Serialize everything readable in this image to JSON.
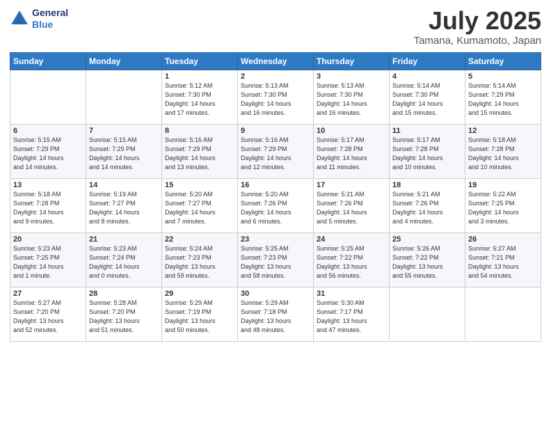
{
  "header": {
    "logo_line1": "General",
    "logo_line2": "Blue",
    "month": "July 2025",
    "location": "Tamana, Kumamoto, Japan"
  },
  "days_of_week": [
    "Sunday",
    "Monday",
    "Tuesday",
    "Wednesday",
    "Thursday",
    "Friday",
    "Saturday"
  ],
  "weeks": [
    [
      {
        "num": "",
        "info": ""
      },
      {
        "num": "",
        "info": ""
      },
      {
        "num": "1",
        "info": "Sunrise: 5:12 AM\nSunset: 7:30 PM\nDaylight: 14 hours\nand 17 minutes."
      },
      {
        "num": "2",
        "info": "Sunrise: 5:13 AM\nSunset: 7:30 PM\nDaylight: 14 hours\nand 16 minutes."
      },
      {
        "num": "3",
        "info": "Sunrise: 5:13 AM\nSunset: 7:30 PM\nDaylight: 14 hours\nand 16 minutes."
      },
      {
        "num": "4",
        "info": "Sunrise: 5:14 AM\nSunset: 7:30 PM\nDaylight: 14 hours\nand 15 minutes."
      },
      {
        "num": "5",
        "info": "Sunrise: 5:14 AM\nSunset: 7:29 PM\nDaylight: 14 hours\nand 15 minutes."
      }
    ],
    [
      {
        "num": "6",
        "info": "Sunrise: 5:15 AM\nSunset: 7:29 PM\nDaylight: 14 hours\nand 14 minutes."
      },
      {
        "num": "7",
        "info": "Sunrise: 5:15 AM\nSunset: 7:29 PM\nDaylight: 14 hours\nand 14 minutes."
      },
      {
        "num": "8",
        "info": "Sunrise: 5:16 AM\nSunset: 7:29 PM\nDaylight: 14 hours\nand 13 minutes."
      },
      {
        "num": "9",
        "info": "Sunrise: 5:16 AM\nSunset: 7:29 PM\nDaylight: 14 hours\nand 12 minutes."
      },
      {
        "num": "10",
        "info": "Sunrise: 5:17 AM\nSunset: 7:28 PM\nDaylight: 14 hours\nand 11 minutes."
      },
      {
        "num": "11",
        "info": "Sunrise: 5:17 AM\nSunset: 7:28 PM\nDaylight: 14 hours\nand 10 minutes."
      },
      {
        "num": "12",
        "info": "Sunrise: 5:18 AM\nSunset: 7:28 PM\nDaylight: 14 hours\nand 10 minutes."
      }
    ],
    [
      {
        "num": "13",
        "info": "Sunrise: 5:18 AM\nSunset: 7:28 PM\nDaylight: 14 hours\nand 9 minutes."
      },
      {
        "num": "14",
        "info": "Sunrise: 5:19 AM\nSunset: 7:27 PM\nDaylight: 14 hours\nand 8 minutes."
      },
      {
        "num": "15",
        "info": "Sunrise: 5:20 AM\nSunset: 7:27 PM\nDaylight: 14 hours\nand 7 minutes."
      },
      {
        "num": "16",
        "info": "Sunrise: 5:20 AM\nSunset: 7:26 PM\nDaylight: 14 hours\nand 6 minutes."
      },
      {
        "num": "17",
        "info": "Sunrise: 5:21 AM\nSunset: 7:26 PM\nDaylight: 14 hours\nand 5 minutes."
      },
      {
        "num": "18",
        "info": "Sunrise: 5:21 AM\nSunset: 7:26 PM\nDaylight: 14 hours\nand 4 minutes."
      },
      {
        "num": "19",
        "info": "Sunrise: 5:22 AM\nSunset: 7:25 PM\nDaylight: 14 hours\nand 3 minutes."
      }
    ],
    [
      {
        "num": "20",
        "info": "Sunrise: 5:23 AM\nSunset: 7:25 PM\nDaylight: 14 hours\nand 1 minute."
      },
      {
        "num": "21",
        "info": "Sunrise: 5:23 AM\nSunset: 7:24 PM\nDaylight: 14 hours\nand 0 minutes."
      },
      {
        "num": "22",
        "info": "Sunrise: 5:24 AM\nSunset: 7:23 PM\nDaylight: 13 hours\nand 59 minutes."
      },
      {
        "num": "23",
        "info": "Sunrise: 5:25 AM\nSunset: 7:23 PM\nDaylight: 13 hours\nand 58 minutes."
      },
      {
        "num": "24",
        "info": "Sunrise: 5:25 AM\nSunset: 7:22 PM\nDaylight: 13 hours\nand 56 minutes."
      },
      {
        "num": "25",
        "info": "Sunrise: 5:26 AM\nSunset: 7:22 PM\nDaylight: 13 hours\nand 55 minutes."
      },
      {
        "num": "26",
        "info": "Sunrise: 5:27 AM\nSunset: 7:21 PM\nDaylight: 13 hours\nand 54 minutes."
      }
    ],
    [
      {
        "num": "27",
        "info": "Sunrise: 5:27 AM\nSunset: 7:20 PM\nDaylight: 13 hours\nand 52 minutes."
      },
      {
        "num": "28",
        "info": "Sunrise: 5:28 AM\nSunset: 7:20 PM\nDaylight: 13 hours\nand 51 minutes."
      },
      {
        "num": "29",
        "info": "Sunrise: 5:29 AM\nSunset: 7:19 PM\nDaylight: 13 hours\nand 50 minutes."
      },
      {
        "num": "30",
        "info": "Sunrise: 5:29 AM\nSunset: 7:18 PM\nDaylight: 13 hours\nand 48 minutes."
      },
      {
        "num": "31",
        "info": "Sunrise: 5:30 AM\nSunset: 7:17 PM\nDaylight: 13 hours\nand 47 minutes."
      },
      {
        "num": "",
        "info": ""
      },
      {
        "num": "",
        "info": ""
      }
    ]
  ]
}
